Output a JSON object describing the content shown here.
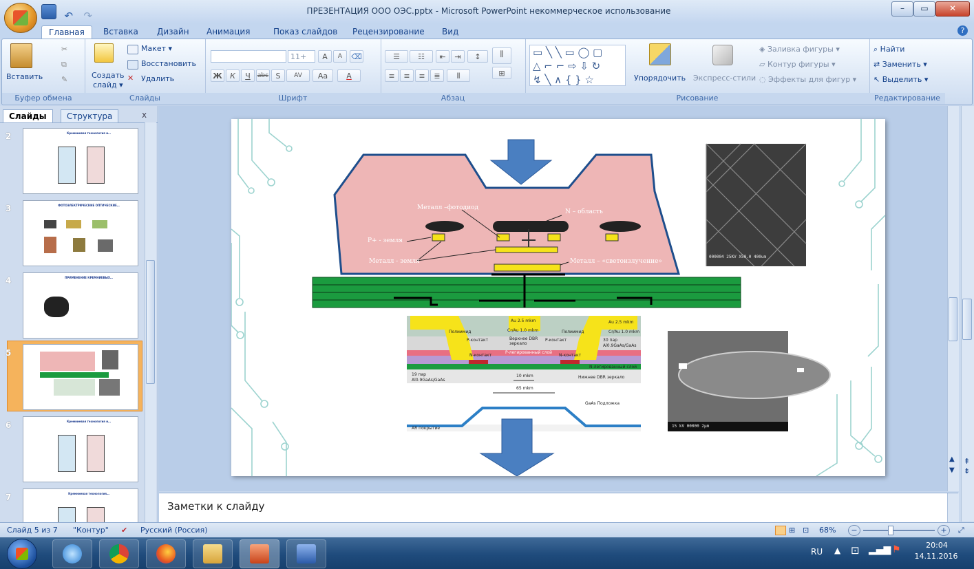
{
  "window": {
    "title": "ПРЕЗЕНТАЦИЯ ООО ОЭС.pptx - Microsoft PowerPoint некоммерческое использование",
    "minimize": "–",
    "maximize": "▭",
    "close": "✕"
  },
  "tabs": [
    "Главная",
    "Вставка",
    "Дизайн",
    "Анимация",
    "Показ слайдов",
    "Рецензирование",
    "Вид"
  ],
  "help_icon": "?",
  "ribbon": {
    "clipboard": {
      "label": "Буфер обмена",
      "paste": "Вставить"
    },
    "slides": {
      "label": "Слайды",
      "new_slide_1": "Создать",
      "new_slide_2": "слайд ▾",
      "layout": "Макет ▾",
      "reset": "Восстановить",
      "delete": "Удалить"
    },
    "font": {
      "label": "Шрифт",
      "font_size": "11+",
      "grow": "A",
      "shrink": "A",
      "bold": "Ж",
      "italic": "К",
      "underline": "Ч",
      "strike": "abc",
      "shadow": "S",
      "spacing": "AV",
      "case": "Aa",
      "color": "A"
    },
    "paragraph": {
      "label": "Абзац"
    },
    "drawing": {
      "label": "Рисование",
      "arrange": "Упорядочить",
      "quick_styles": "Экспресс-стили",
      "fill": "Заливка фигуры ▾",
      "outline": "Контур фигуры ▾",
      "effects": "Эффекты для фигур ▾"
    },
    "editing": {
      "label": "Редактирование",
      "find": "Найти",
      "replace": "Заменить ▾",
      "select": "Выделить ▾"
    }
  },
  "panel": {
    "tab_slides": "Слайды",
    "tab_outline": "Структура",
    "close": "x",
    "thumbs": [
      {
        "num": "2",
        "title": "Кремниевая технология и…"
      },
      {
        "num": "3",
        "title": "ФОТОЭЛЕКТРИЧЕСКИЕ ОПТИЧЕСКИЕ…"
      },
      {
        "num": "4",
        "title": "ПРИМЕНЕНИЕ КРЕМНИЕВЫХ…"
      },
      {
        "num": "5",
        "title": ""
      },
      {
        "num": "6",
        "title": "Кремниевая технология и…"
      },
      {
        "num": "7",
        "title": "Кремниевая технология…"
      }
    ]
  },
  "slide": {
    "metal_photodiode": "Металл –фотодиод",
    "n_region": "N – область",
    "p_ground": "P+ - земля",
    "metal_ground": "Металл - земля",
    "metal_emission": "Металл – «светоизлучение»",
    "au_left": "Au 2.5 mkm",
    "au_right": "Au 2.5 mkm",
    "cr_au": "Cr/Au 1.0 mkm",
    "cr_au_right": "Cr/Au 1.0 mkm",
    "polyimide_left": "Полиимид",
    "polyimide_right": "Полиимид",
    "p_contact_left": "P-контакт",
    "p_contact_right": "P-контакт",
    "upper_dbr": "Верхнее DBR зеркало",
    "pairs_30": "30 пар",
    "algaas_30": "Al0.9GaAs/GaAs",
    "n_contact_left": "N-контакт",
    "n_contact_right": "N-контакт",
    "p_doped": "P-легированный слой",
    "n_doped": "N-легированный слой",
    "pairs_19": "19 пар",
    "algaas_19": "Al0.9GaAs/GaAs",
    "size_10": "10 mkm",
    "lower_dbr": "Нижнее DBR зеркало",
    "size_65": "65 mkm",
    "gaas_substrate": "GaAs Подложка",
    "ar_coating": "AR покрытие",
    "sem1_caption": "000004 25KV X50.0 400um",
    "sem2_caption": "15 kV   00000   2μm"
  },
  "notes": {
    "placeholder": "Заметки к слайду"
  },
  "status": {
    "slide_info": "Слайд 5 из 7",
    "theme": "\"Контур\"",
    "language": "Русский (Россия)",
    "zoom": "68%",
    "zoom_value": 68
  },
  "taskbar": {
    "lang": "RU",
    "time": "20:04",
    "date": "14.11.2016"
  },
  "colors": {
    "pink": "#eeb6b6",
    "green": "#1b9b3f",
    "blue_arrow": "#4a7fc1",
    "yellow": "#f6e31a"
  }
}
